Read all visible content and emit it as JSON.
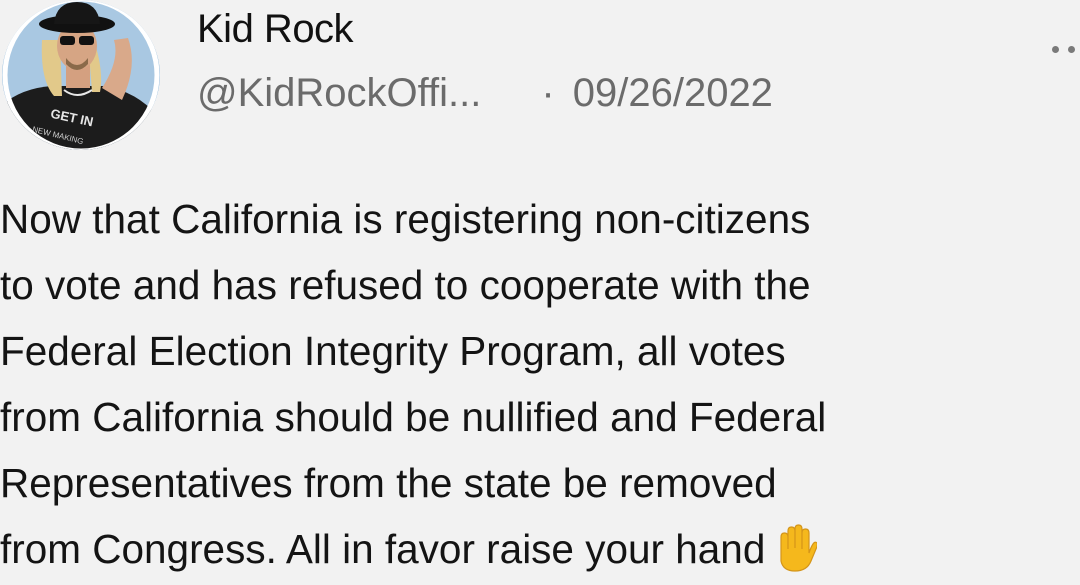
{
  "user": {
    "display_name": "Kid Rock",
    "handle": "@KidRockOffi...",
    "separator": "·",
    "date": "09/26/2022",
    "avatar_shirt_text": "GET IN"
  },
  "tweet": {
    "lines": [
      "Now that California is registering non-citizens",
      "to vote and has refused to cooperate with the",
      "Federal Election Integrity Program, all votes",
      "from California should be nullified and Federal",
      "Representatives from the state be removed",
      "from Congress. All in favor raise your hand"
    ],
    "emoji": "raised-hand-icon"
  },
  "menu": {
    "icon": "more-options-icon"
  },
  "colors": {
    "background": "#f2f2f2",
    "text": "#141414",
    "secondary": "#6b6b6b",
    "emoji": "#f5b81c"
  }
}
